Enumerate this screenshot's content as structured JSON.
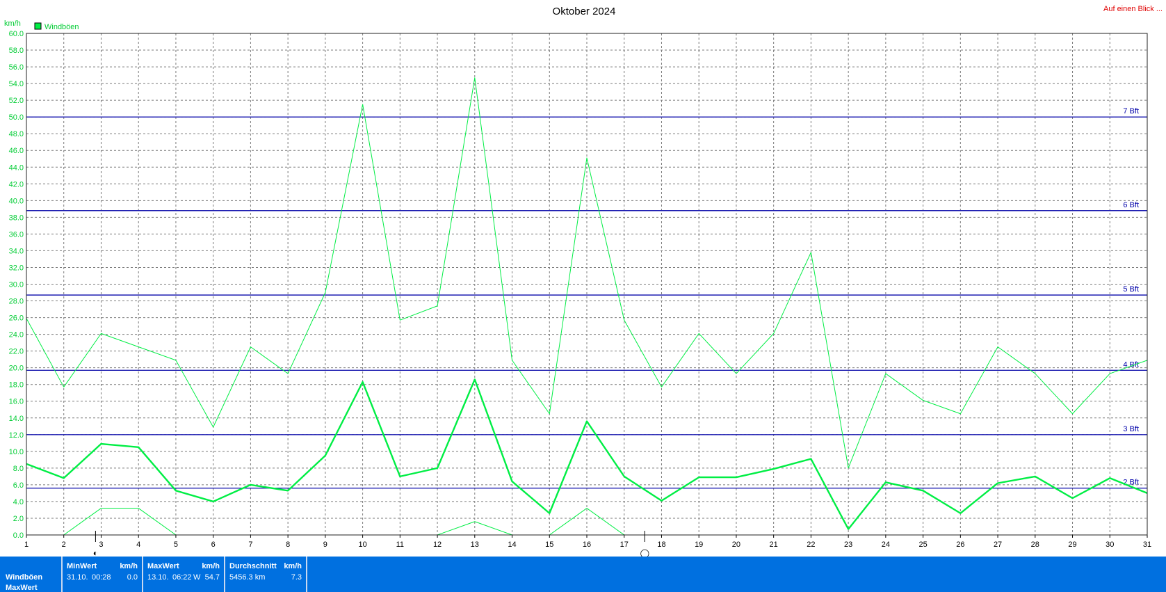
{
  "header": {
    "title": "Oktober 2024",
    "link_label": "Auf einen Blick ...",
    "unit": "km/h",
    "legend_label": "Windböen"
  },
  "colors": {
    "series": "#00ee44",
    "bft": "#1a1ab0",
    "link": "#e00000",
    "stats_bg": "#0070e0"
  },
  "chart_data": {
    "type": "line",
    "title": "Oktober 2024",
    "ylabel": "km/h",
    "xlabel": "",
    "x": [
      1,
      2,
      3,
      4,
      5,
      6,
      7,
      8,
      9,
      10,
      11,
      12,
      13,
      14,
      15,
      16,
      17,
      18,
      19,
      20,
      21,
      22,
      23,
      24,
      25,
      26,
      27,
      28,
      29,
      30,
      31
    ],
    "xlim": [
      1,
      31
    ],
    "ylim": [
      0,
      60
    ],
    "ytick_step": 2,
    "grid": true,
    "legend": "top-left",
    "series": [
      {
        "name": "Windböen",
        "role": "max",
        "values": [
          25.9,
          17.7,
          24.1,
          22.5,
          20.9,
          12.9,
          22.5,
          19.3,
          29.0,
          51.5,
          25.7,
          27.4,
          54.7,
          20.9,
          14.5,
          45.1,
          25.7,
          17.7,
          24.1,
          19.3,
          24.1,
          33.8,
          8.0,
          19.3,
          16.1,
          14.5,
          22.5,
          19.3,
          14.5,
          19.3,
          20.9
        ]
      },
      {
        "name": "",
        "role": "avg",
        "values": [
          8.5,
          6.8,
          10.9,
          10.5,
          5.3,
          4.0,
          6.0,
          5.3,
          9.5,
          18.3,
          7.0,
          8.0,
          18.6,
          6.4,
          2.6,
          13.6,
          7.0,
          4.1,
          6.9,
          6.9,
          7.9,
          9.1,
          0.7,
          6.3,
          5.3,
          2.6,
          6.2,
          7.0,
          4.4,
          6.8,
          5.0
        ]
      },
      {
        "name": "",
        "role": "min",
        "values": [
          null,
          0.0,
          3.2,
          3.2,
          0.0,
          null,
          null,
          null,
          null,
          null,
          null,
          0.0,
          1.6,
          0.0,
          0.0,
          3.2,
          0.0,
          null,
          null,
          null,
          null,
          null,
          null,
          null,
          null,
          null,
          null,
          null,
          null,
          null,
          null
        ]
      }
    ],
    "bft_lines": [
      {
        "label": "7 Bft",
        "value": 50.0
      },
      {
        "label": "6 Bft",
        "value": 38.8
      },
      {
        "label": "5 Bft",
        "value": 28.7
      },
      {
        "label": "4 Bft",
        "value": 19.7
      },
      {
        "label": "3 Bft",
        "value": 12.0
      },
      {
        "label": "2 Bft",
        "value": 5.6
      }
    ],
    "moon_phases": [
      {
        "day": 2.85,
        "symbol": "◐"
      },
      {
        "day": 17.55,
        "symbol": "◯"
      }
    ]
  },
  "stats": {
    "row_labels": [
      "Windböen",
      "MaxWert"
    ],
    "min": {
      "header": "MinWert",
      "unit": "km/h",
      "date": "31.10.",
      "time": "00:28",
      "value": "0.0"
    },
    "max": {
      "header": "MaxWert",
      "unit": "km/h",
      "date": "13.10.",
      "time": "06:22",
      "dir": "W",
      "value": "54.7"
    },
    "avg": {
      "header": "Durchschnitt",
      "unit": "km/h",
      "distance": "5456.3 km",
      "value": "7.3"
    }
  }
}
